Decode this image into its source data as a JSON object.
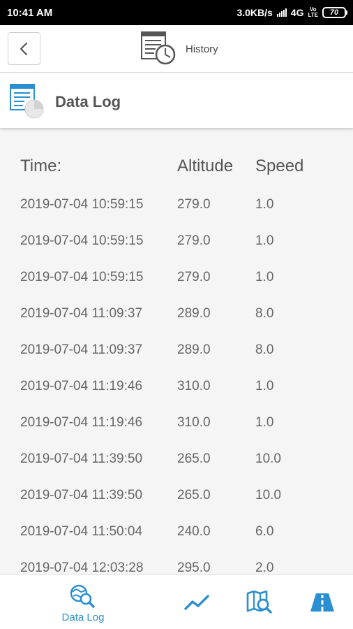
{
  "status_bar": {
    "time": "10:41 AM",
    "network_speed": "3.0KB/s",
    "network_type": "4G",
    "volte_top": "Vo",
    "volte_bottom": "LTE",
    "battery": "70"
  },
  "header": {
    "title": "History",
    "back_icon": "chevron-left-icon",
    "history_icon": "history-icon"
  },
  "section": {
    "title": "Data Log",
    "icon": "data-log-icon"
  },
  "table": {
    "columns": [
      "Time:",
      "Altitude",
      "Speed"
    ],
    "rows": [
      [
        "2019-07-04 10:59:15",
        "279.0",
        "1.0"
      ],
      [
        "2019-07-04 10:59:15",
        "279.0",
        "1.0"
      ],
      [
        "2019-07-04 10:59:15",
        "279.0",
        "1.0"
      ],
      [
        "2019-07-04 11:09:37",
        "289.0",
        "8.0"
      ],
      [
        "2019-07-04 11:09:37",
        "289.0",
        "8.0"
      ],
      [
        "2019-07-04 11:19:46",
        "310.0",
        "1.0"
      ],
      [
        "2019-07-04 11:19:46",
        "310.0",
        "1.0"
      ],
      [
        "2019-07-04 11:39:50",
        "265.0",
        "10.0"
      ],
      [
        "2019-07-04 11:39:50",
        "265.0",
        "10.0"
      ],
      [
        "2019-07-04 11:50:04",
        "240.0",
        "6.0"
      ],
      [
        "2019-07-04 12:03:28",
        "295.0",
        "2.0"
      ]
    ]
  },
  "bottom_nav": {
    "items": [
      {
        "label": "Data Log",
        "icon": "data-log-search-icon",
        "active": true
      },
      {
        "label": "",
        "icon": "trend-chart-icon",
        "active": false
      },
      {
        "label": "",
        "icon": "map-search-icon",
        "active": false
      },
      {
        "label": "",
        "icon": "road-icon",
        "active": false
      }
    ]
  },
  "colors": {
    "accent": "#2a8fd0",
    "text_primary": "#555555",
    "text_secondary": "#666666",
    "background": "#f5f5f5"
  }
}
